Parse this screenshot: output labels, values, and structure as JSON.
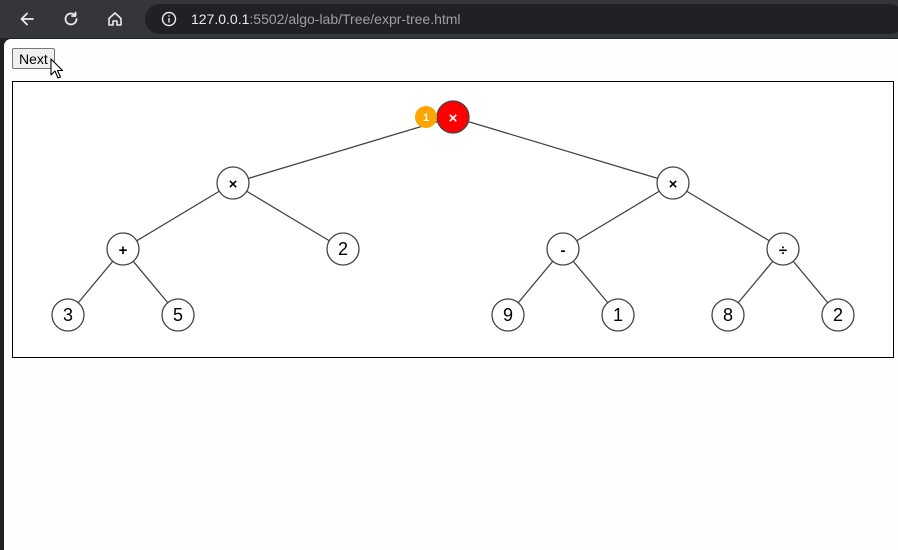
{
  "browser": {
    "url_host": "127.0.0.1",
    "url_rest": ":5502/algo-lab/Tree/expr-tree.html"
  },
  "page": {
    "next_label": "Next"
  },
  "tree": {
    "active_step": "1",
    "nodes": [
      {
        "id": "n0",
        "label": "×",
        "level": 0,
        "slot": 0,
        "active": true
      },
      {
        "id": "n1",
        "label": "×",
        "level": 1,
        "slot": 0
      },
      {
        "id": "n2",
        "label": "×",
        "level": 1,
        "slot": 1
      },
      {
        "id": "n3",
        "label": "+",
        "level": 2,
        "slot": 0
      },
      {
        "id": "n4",
        "label": "2",
        "level": 2,
        "slot": 1
      },
      {
        "id": "n5",
        "label": "-",
        "level": 2,
        "slot": 2
      },
      {
        "id": "n6",
        "label": "÷",
        "level": 2,
        "slot": 3
      },
      {
        "id": "n7",
        "label": "3",
        "level": 3,
        "slot": 0
      },
      {
        "id": "n8",
        "label": "5",
        "level": 3,
        "slot": 1
      },
      {
        "id": "n9",
        "label": "9",
        "level": 3,
        "slot": 4
      },
      {
        "id": "n10",
        "label": "1",
        "level": 3,
        "slot": 5
      },
      {
        "id": "n11",
        "label": "8",
        "level": 3,
        "slot": 6
      },
      {
        "id": "n12",
        "label": "2",
        "level": 3,
        "slot": 7
      }
    ],
    "edges": [
      [
        "n0",
        "n1"
      ],
      [
        "n0",
        "n2"
      ],
      [
        "n1",
        "n3"
      ],
      [
        "n1",
        "n4"
      ],
      [
        "n2",
        "n5"
      ],
      [
        "n2",
        "n6"
      ],
      [
        "n3",
        "n7"
      ],
      [
        "n3",
        "n8"
      ],
      [
        "n5",
        "n9"
      ],
      [
        "n5",
        "n10"
      ],
      [
        "n6",
        "n11"
      ],
      [
        "n6",
        "n12"
      ]
    ],
    "colors": {
      "active_fill": "#ff0000",
      "active_text": "#ffffff",
      "badge_fill": "#ffa500",
      "node_fill": "#ffffff",
      "node_stroke": "#444444",
      "edge": "#444444"
    }
  }
}
